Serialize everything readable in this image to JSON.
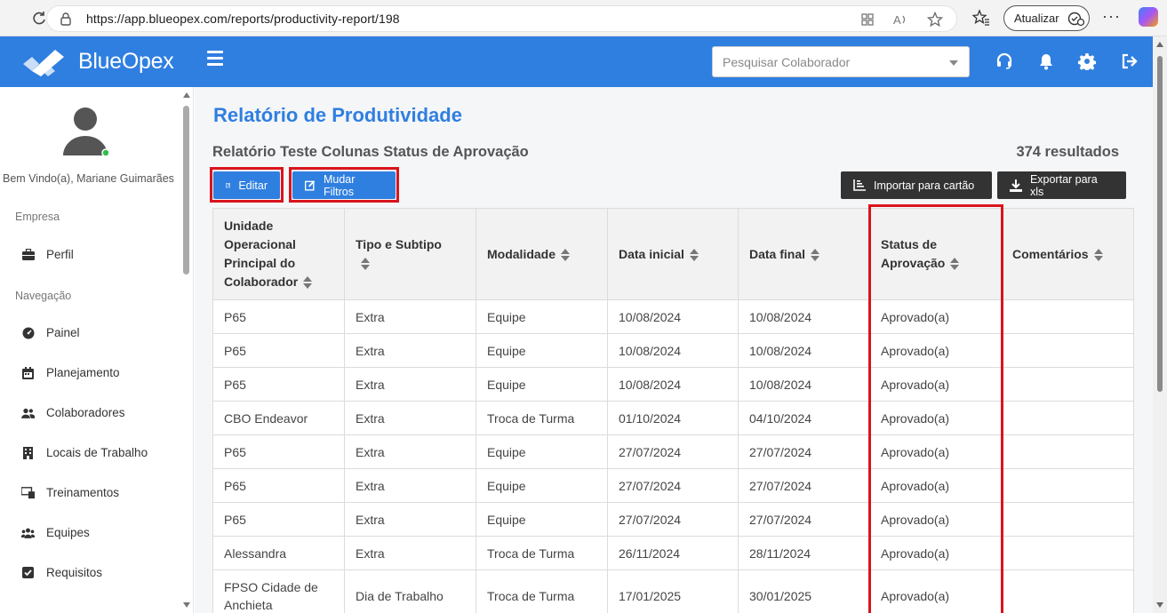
{
  "browser": {
    "url": "https://app.blueopex.com/reports/productivity-report/198",
    "update_label": "Atualizar"
  },
  "header": {
    "brand": "BlueOpex",
    "search_placeholder": "Pesquisar Colaborador",
    "brand_color": "#2f7fe0"
  },
  "sidebar": {
    "welcome": "Bem Vindo(a), Mariane Guimarães",
    "section_company": "Empresa",
    "section_nav": "Navegação",
    "company_items": [
      {
        "label": "Perfil",
        "icon": "briefcase-icon"
      }
    ],
    "nav_items": [
      {
        "label": "Painel",
        "icon": "dashboard-icon"
      },
      {
        "label": "Planejamento",
        "icon": "calendar-icon"
      },
      {
        "label": "Colaboradores",
        "icon": "users-icon"
      },
      {
        "label": "Locais de Trabalho",
        "icon": "building-icon"
      },
      {
        "label": "Treinamentos",
        "icon": "training-icon"
      },
      {
        "label": "Equipes",
        "icon": "team-icon"
      },
      {
        "label": "Requisitos",
        "icon": "checkbox-icon"
      }
    ]
  },
  "main": {
    "title": "Relatório de Produtividade",
    "report_name": "Relatório Teste Colunas Status de Aprovação",
    "results": "374 resultados",
    "edit_label": "Editar",
    "filters_label": "Mudar Filtros",
    "import_label": "Importar para cartão",
    "export_label": "Exportar para xls"
  },
  "table": {
    "headers": [
      "Unidade Operacional Principal do Colaborador",
      "Tipo e Subtipo",
      "Modalidade",
      "Data inicial",
      "Data final",
      "Status de Aprovação",
      "Comentários"
    ],
    "rows": [
      [
        "P65",
        "Extra",
        "Equipe",
        "10/08/2024",
        "10/08/2024",
        "Aprovado(a)",
        ""
      ],
      [
        "P65",
        "Extra",
        "Equipe",
        "10/08/2024",
        "10/08/2024",
        "Aprovado(a)",
        ""
      ],
      [
        "P65",
        "Extra",
        "Equipe",
        "10/08/2024",
        "10/08/2024",
        "Aprovado(a)",
        ""
      ],
      [
        "CBO Endeavor",
        "Extra",
        "Troca de Turma",
        "01/10/2024",
        "04/10/2024",
        "Aprovado(a)",
        ""
      ],
      [
        "P65",
        "Extra",
        "Equipe",
        "27/07/2024",
        "27/07/2024",
        "Aprovado(a)",
        ""
      ],
      [
        "P65",
        "Extra",
        "Equipe",
        "27/07/2024",
        "27/07/2024",
        "Aprovado(a)",
        ""
      ],
      [
        "P65",
        "Extra",
        "Equipe",
        "27/07/2024",
        "27/07/2024",
        "Aprovado(a)",
        ""
      ],
      [
        "Alessandra",
        "Extra",
        "Troca de Turma",
        "26/11/2024",
        "28/11/2024",
        "Aprovado(a)",
        ""
      ],
      [
        "FPSO Cidade de Anchieta",
        "Dia de Trabalho",
        "Troca de Turma",
        "17/01/2025",
        "30/01/2025",
        "Aprovado(a)",
        ""
      ]
    ]
  }
}
